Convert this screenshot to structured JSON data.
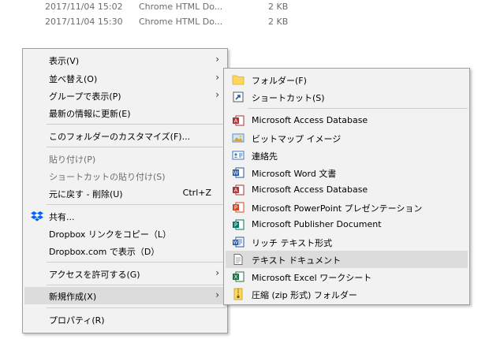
{
  "files": [
    {
      "date": "2017/11/04 15:02",
      "type": "Chrome HTML Do...",
      "size": "2 KB"
    },
    {
      "date": "2017/11/04 15:30",
      "type": "Chrome HTML Do...",
      "size": "2 KB"
    }
  ],
  "context_menu": {
    "view": "表示(V)",
    "sort_by": "並べ替え(O)",
    "group_by": "グループで表示(P)",
    "refresh": "最新の情報に更新(E)",
    "customize_folder": "このフォルダーのカスタマイズ(F)...",
    "paste": "貼り付け(P)",
    "paste_shortcut": "ショートカットの貼り付け(S)",
    "undo_delete": "元に戻す - 削除(U)",
    "undo_shortcut": "Ctrl+Z",
    "share": "共有...",
    "dropbox_copy_link": "Dropbox リンクをコピー（L）",
    "dropbox_view": "Dropbox.com で表示（D）",
    "give_access": "アクセスを許可する(G)",
    "new": "新規作成(X)",
    "properties": "プロパティ(R)",
    "submenu_arrow": "›"
  },
  "new_submenu": {
    "folder": "フォルダー(F)",
    "shortcut": "ショートカット(S)",
    "access_db_1": "Microsoft Access Database",
    "bitmap": "ビットマップ イメージ",
    "contact": "連絡先",
    "word": "Microsoft Word 文書",
    "access_db_2": "Microsoft Access Database",
    "powerpoint": "Microsoft PowerPoint プレゼンテーション",
    "publisher": "Microsoft Publisher Document",
    "rtf": "リッチ テキスト形式",
    "text": "テキスト ドキュメント",
    "excel": "Microsoft Excel ワークシート",
    "zip": "圧縮 (zip 形式) フォルダー"
  },
  "colors": {
    "menu_bg": "#f2f2f2",
    "highlight": "#dcdcdc",
    "disabled_text": "#6d6d6d",
    "dropbox_blue": "#0061fe",
    "folder_yellow": "#ffd75e",
    "access_red": "#a4373a",
    "word_blue": "#2b579a",
    "ppt_orange": "#d24726",
    "publisher_teal": "#077568",
    "excel_green": "#217346"
  },
  "icons": {
    "share": "dropbox-icon",
    "folder": "folder-icon",
    "shortcut": "shortcut-arrow-icon",
    "access": "access-icon",
    "bitmap": "bitmap-icon",
    "contact": "contact-card-icon",
    "word": "word-icon",
    "powerpoint": "powerpoint-icon",
    "publisher": "publisher-icon",
    "rtf": "rich-text-icon",
    "text": "text-document-icon",
    "excel": "excel-icon",
    "zip": "zip-folder-icon"
  }
}
